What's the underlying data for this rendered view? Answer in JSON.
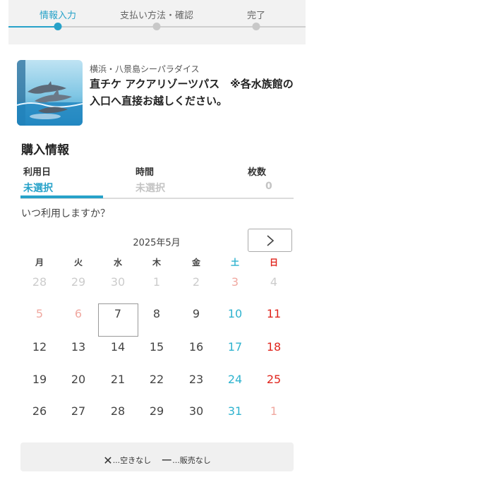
{
  "steps": {
    "items": [
      {
        "label": "情報入力",
        "active": true
      },
      {
        "label": "支払い方法・確認",
        "active": false
      },
      {
        "label": "完了",
        "active": false
      }
    ]
  },
  "product": {
    "venue": "横浜・八景島シーパラダイス",
    "title": "直チケ アクアリゾーツパス　※各水族館の入口へ直接お越しください。",
    "thumbnail_icon": "dolphin-photo"
  },
  "purchase": {
    "section_title": "購入情報",
    "columns": [
      {
        "label": "利用日",
        "value": "未選択"
      },
      {
        "label": "時間",
        "value": "未選択"
      },
      {
        "label": "枚数",
        "value": "0"
      }
    ],
    "question": "いつ利用しますか？"
  },
  "calendar": {
    "month_label": "2025年5月",
    "next_icon": "chevron-right-icon",
    "weekdays": [
      "月",
      "火",
      "水",
      "木",
      "金",
      "土",
      "日"
    ],
    "weeks": [
      [
        "28",
        "29",
        "30",
        "1",
        "2",
        "3",
        "4"
      ],
      [
        "5",
        "6",
        "7",
        "8",
        "9",
        "10",
        "11"
      ],
      [
        "12",
        "13",
        "14",
        "15",
        "16",
        "17",
        "18"
      ],
      [
        "19",
        "20",
        "21",
        "22",
        "23",
        "24",
        "25"
      ],
      [
        "26",
        "27",
        "28",
        "29",
        "30",
        "31",
        "1"
      ]
    ],
    "selected_day": "7",
    "colors": {
      "saturday": "#2fb3cf",
      "sunday": "#e0261e",
      "accent": "#27a2c9"
    }
  },
  "legend": {
    "unavailable_symbol": "✕",
    "unavailable_text": "...空きなし",
    "not_sold_symbol": "ー",
    "not_sold_text": "...販売なし"
  }
}
